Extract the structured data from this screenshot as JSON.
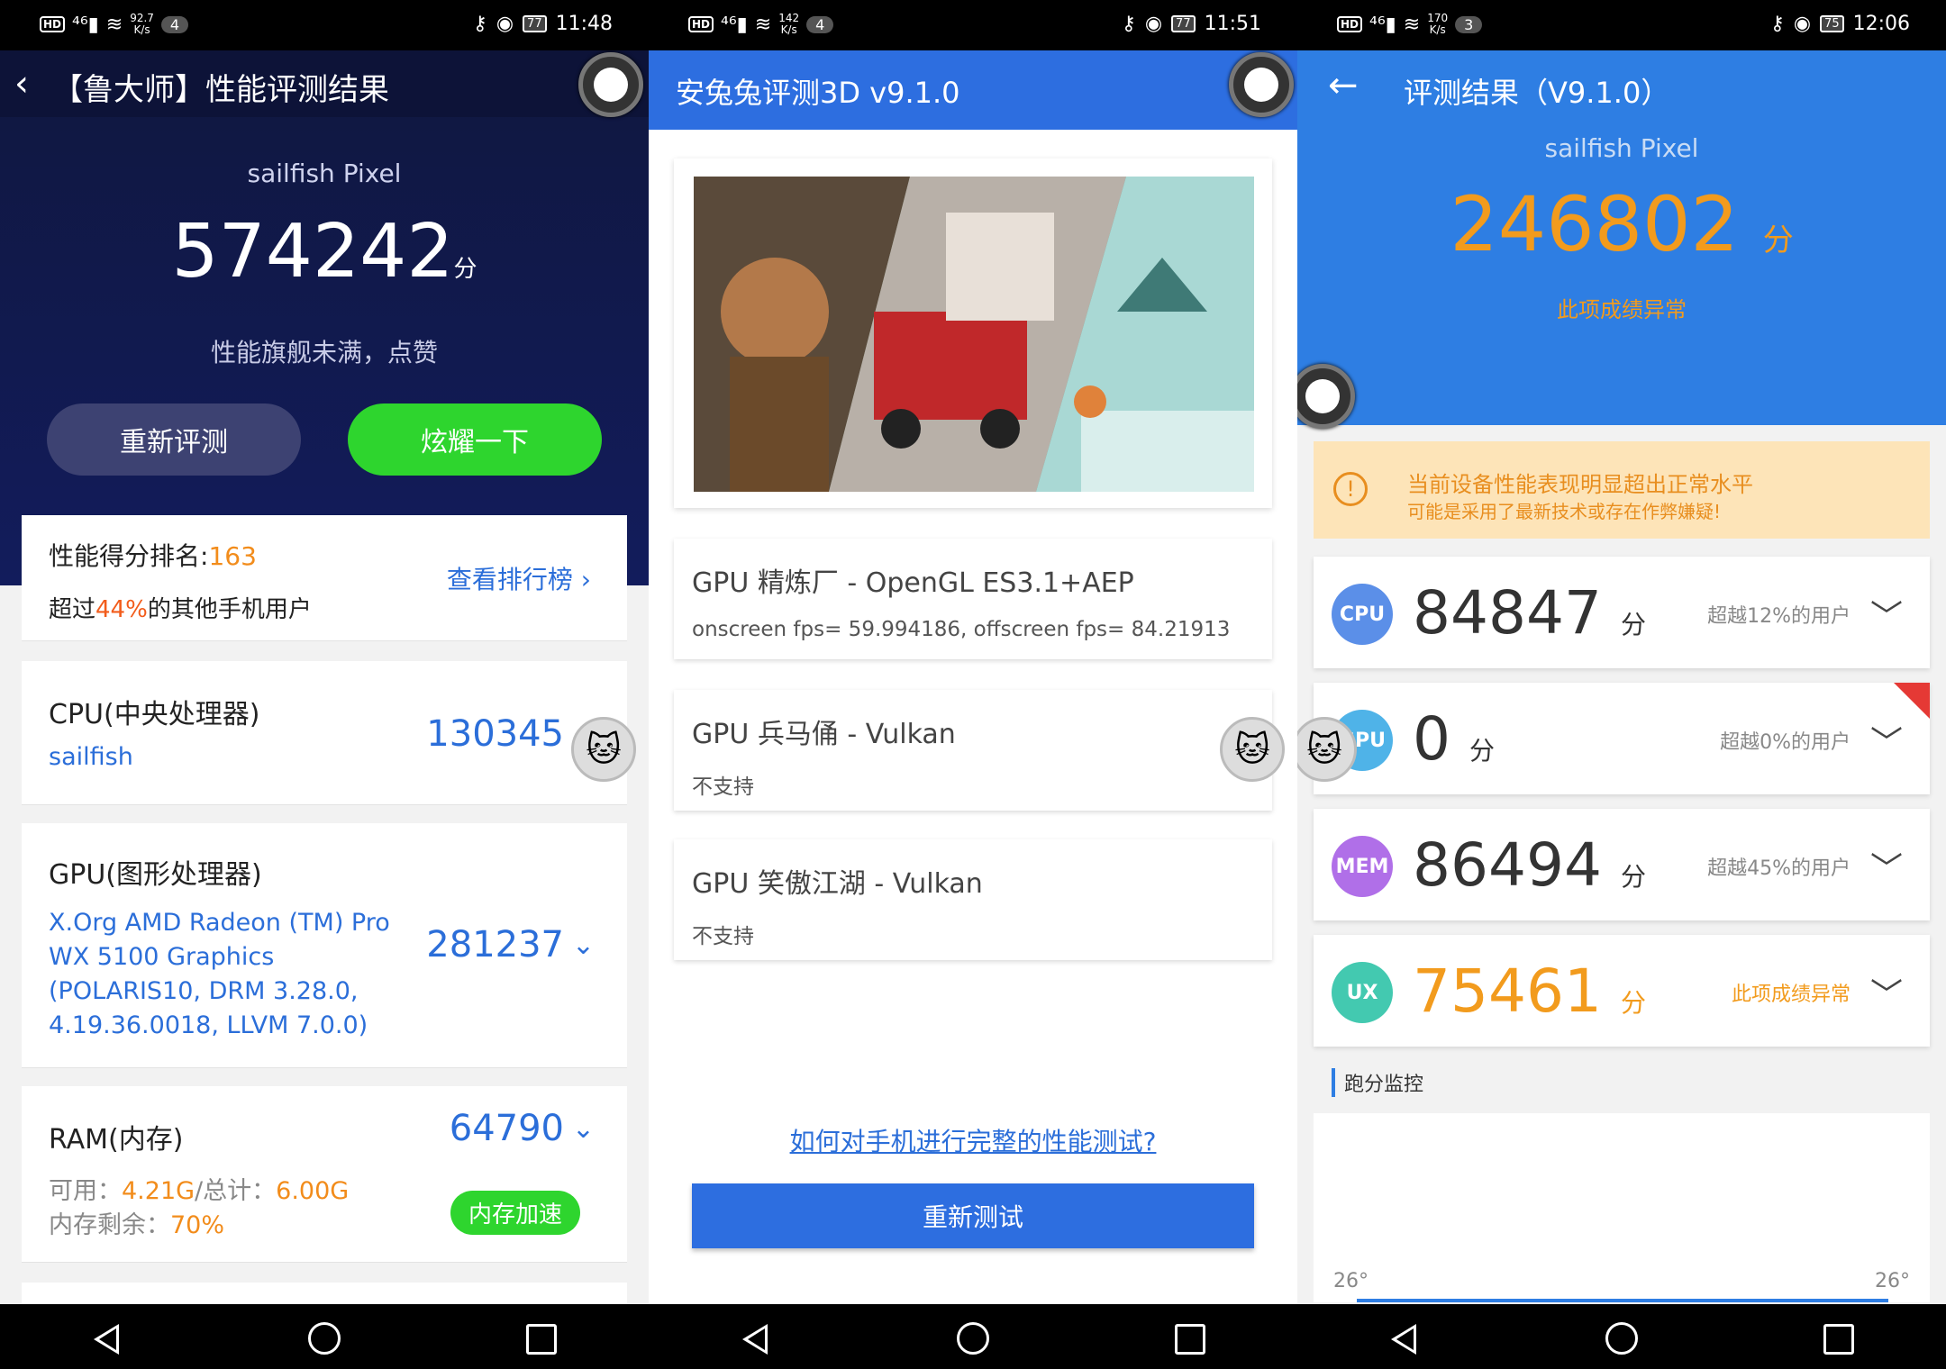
{
  "status": [
    {
      "speed": "92.7\nK/s",
      "notif": "4",
      "bat": "77",
      "time": "11:48"
    },
    {
      "speed": "142\nK/s",
      "notif": "4",
      "bat": "77",
      "time": "11:51"
    },
    {
      "speed": "170\nK/s",
      "notif": "3",
      "bat": "75",
      "time": "12:06"
    }
  ],
  "p1": {
    "title": "【鲁大师】性能评测结果",
    "device": "sailfish Pixel",
    "score": "574242",
    "score_unit": "分",
    "slogan": "性能旗舰未满，点赞",
    "btn_retest": "重新评测",
    "btn_share": "炫耀一下",
    "rank_label": "性能得分排名:",
    "rank": "163",
    "beat_pre": "超过",
    "beat_pct": "44%",
    "beat_post": "的其他手机用户",
    "view_rank": "查看排行榜 ›",
    "cpu_name": "CPU(中央处理器)",
    "cpu_sub": "sailfish",
    "cpu_val": "130345",
    "gpu_name": "GPU(图形处理器)",
    "gpu_sub": "X.Org AMD Radeon (TM) Pro WX 5100 Graphics (POLARIS10, DRM 3.28.0, 4.19.36.0018, LLVM 7.0.0)",
    "gpu_val": "281237",
    "ram_name": "RAM(内存)",
    "ram_val": "64790",
    "ram_avail_label": "可用：",
    "ram_avail": "4.21G",
    "ram_total_label": "/总计：",
    "ram_total": "6.00G",
    "ram_free_label": "内存剩余：",
    "ram_free": "70%",
    "ram_btn": "内存加速"
  },
  "p2": {
    "title": "安兔兔评测3D v9.1.0",
    "g1_name": "GPU 精炼厂 - OpenGL ES3.1+AEP",
    "g1_desc": "onscreen fps= 59.994186, offscreen fps= 84.21913",
    "g2_name": "GPU 兵马俑 - Vulkan",
    "g2_desc": "不支持",
    "g3_name": "GPU 笑傲江湖 - Vulkan",
    "g3_desc": "不支持",
    "link": "如何对手机进行完整的性能测试?",
    "retest": "重新测试"
  },
  "p3": {
    "title": "评测结果（V9.1.0）",
    "device": "sailfish Pixel",
    "score": "246802",
    "score_unit": "分",
    "abnormal": "此项成绩异常",
    "warn1": "当前设备性能表现明显超出正常水平",
    "warn2": "可能是采用了最新技术或存在作弊嫌疑!",
    "rows": [
      {
        "badge": "CPU",
        "val": "84847",
        "unit": "分",
        "pct": "超越12%的用户",
        "color": "#5b8fe8"
      },
      {
        "badge": "GPU",
        "val": "0",
        "unit": "分",
        "pct": "超越0%的用户",
        "color": "#4fb3e8"
      },
      {
        "badge": "MEM",
        "val": "86494",
        "unit": "分",
        "pct": "超越45%的用户",
        "color": "#b06fe8"
      },
      {
        "badge": "UX",
        "val": "75461",
        "unit": "分",
        "pct": "此项成绩异常",
        "color": "#43c9b0"
      }
    ],
    "monitor": "跑分监控",
    "temp_start": "26°",
    "temp_end": "26°"
  }
}
